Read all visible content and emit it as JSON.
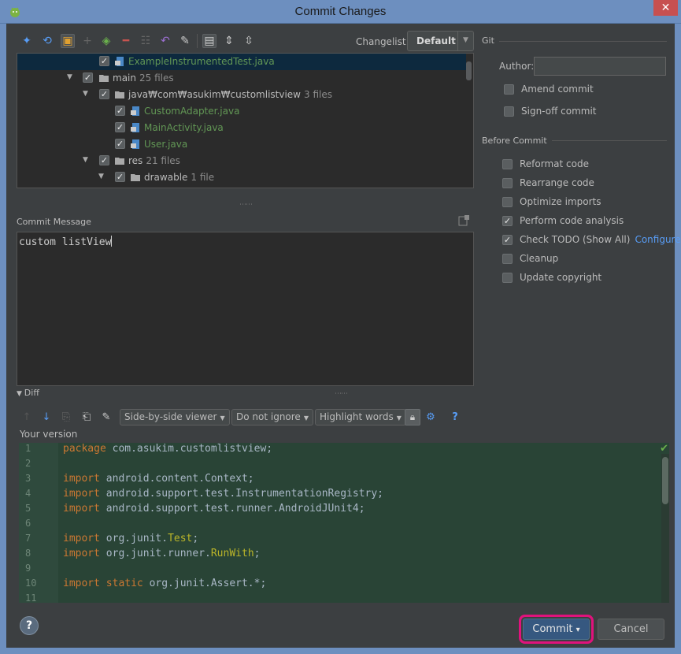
{
  "window": {
    "title": "Commit Changes",
    "close_glyph": "✕"
  },
  "toolbar": {
    "changelist_label": "Changelist:",
    "changelist_value": "Default"
  },
  "tree": {
    "rows": [
      {
        "label": "ExampleInstrumentedTest.java",
        "count": "",
        "kind": "file",
        "selected": true
      },
      {
        "label": "main",
        "count": "25 files",
        "kind": "dir"
      },
      {
        "label": "java₩com₩asukim₩customlistview",
        "count": "3 files",
        "kind": "dir"
      },
      {
        "label": "CustomAdapter.java",
        "count": "",
        "kind": "file"
      },
      {
        "label": "MainActivity.java",
        "count": "",
        "kind": "file"
      },
      {
        "label": "User.java",
        "count": "",
        "kind": "file"
      },
      {
        "label": "res",
        "count": "21 files",
        "kind": "dir"
      },
      {
        "label": "drawable",
        "count": "1 file",
        "kind": "dir"
      }
    ]
  },
  "commit_message": {
    "label": "Commit Message",
    "value": "custom listView"
  },
  "git": {
    "title": "Git",
    "author_label": "Author:",
    "author_value": "",
    "amend_label": "Amend commit",
    "signoff_label": "Sign-off commit"
  },
  "before_commit": {
    "title": "Before Commit",
    "options": [
      {
        "label": "Reformat code",
        "checked": false
      },
      {
        "label": "Rearrange code",
        "checked": false
      },
      {
        "label": "Optimize imports",
        "checked": false
      },
      {
        "label": "Perform code analysis",
        "checked": true
      },
      {
        "label": "Check TODO (Show All)",
        "checked": true
      },
      {
        "label": "Cleanup",
        "checked": false
      },
      {
        "label": "Update copyright",
        "checked": false
      }
    ],
    "configure_link": "Configure"
  },
  "diff": {
    "label": "Diff",
    "viewer_combo": "Side-by-side viewer",
    "ignore_combo": "Do not ignore",
    "highlight_combo": "Highlight words",
    "help_glyph": "?",
    "your_version_label": "Your version",
    "lines": [
      {
        "n": "1",
        "kw": "package",
        "rest": " com.asukim.customlistview;",
        "an": "",
        "tail": ""
      },
      {
        "n": "2",
        "kw": "",
        "rest": "",
        "an": "",
        "tail": ""
      },
      {
        "n": "3",
        "kw": "import",
        "rest": " android.content.Context;",
        "an": "",
        "tail": ""
      },
      {
        "n": "4",
        "kw": "import",
        "rest": " android.support.test.InstrumentationRegistry;",
        "an": "",
        "tail": ""
      },
      {
        "n": "5",
        "kw": "import",
        "rest": " android.support.test.runner.AndroidJUnit4;",
        "an": "",
        "tail": ""
      },
      {
        "n": "6",
        "kw": "",
        "rest": "",
        "an": "",
        "tail": ""
      },
      {
        "n": "7",
        "kw": "import",
        "rest": " org.junit.",
        "an": "Test",
        "tail": ";"
      },
      {
        "n": "8",
        "kw": "import",
        "rest": " org.junit.runner.",
        "an": "RunWith",
        "tail": ";"
      },
      {
        "n": "9",
        "kw": "",
        "rest": "",
        "an": "",
        "tail": ""
      },
      {
        "n": "10",
        "kw": "import static",
        "rest": " org.junit.Assert.*;",
        "an": "",
        "tail": ""
      },
      {
        "n": "11",
        "kw": "",
        "rest": "",
        "an": "",
        "tail": ""
      }
    ]
  },
  "buttons": {
    "help": "?",
    "commit": "Commit",
    "commit_arrow": "▾",
    "cancel": "Cancel"
  },
  "colors": {
    "highlight_ring": "#e0127c",
    "file_green": "#629755",
    "link_blue": "#589df6"
  }
}
